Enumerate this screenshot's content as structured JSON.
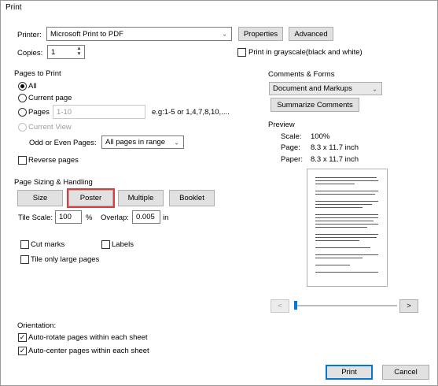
{
  "window": {
    "title": "Print"
  },
  "printer": {
    "label": "Printer:",
    "value": "Microsoft Print to PDF",
    "properties_label": "Properties",
    "advanced_label": "Advanced"
  },
  "copies": {
    "label": "Copies:",
    "value": "1"
  },
  "grayscale": {
    "label": "Print in grayscale(black and white)",
    "checked": false
  },
  "pages_to_print": {
    "heading": "Pages to Print",
    "all_label": "All",
    "current_page_label": "Current page",
    "pages_label": "Pages",
    "pages_placeholder": "1-10",
    "pages_hint": "e.g:1-5 or 1,4,7,8,10,....",
    "current_view_label": "Current View",
    "odd_even_label": "Odd or Even Pages:",
    "odd_even_value": "All pages in range",
    "reverse_label": "Reverse pages"
  },
  "comments_forms": {
    "heading": "Comments & Forms",
    "value": "Document and Markups",
    "summarize_label": "Summarize Comments"
  },
  "preview": {
    "heading": "Preview",
    "scale_label": "Scale:",
    "scale_value": "100%",
    "page_label": "Page:",
    "page_value": "8.3 x 11.7 inch",
    "paper_label": "Paper:",
    "paper_value": "8.3 x 11.7 inch",
    "prev_label": "<",
    "next_label": ">"
  },
  "page_sizing": {
    "heading": "Page Sizing & Handling",
    "tabs": [
      "Size",
      "Poster",
      "Multiple",
      "Booklet"
    ],
    "selected_tab": "Poster",
    "tile_scale_label": "Tile Scale:",
    "tile_scale_value": "100",
    "percent": "%",
    "overlap_label": "Overlap:",
    "overlap_value": "0.005",
    "overlap_unit": "in",
    "cut_marks_label": "Cut marks",
    "labels_label": "Labels",
    "tile_large_label": "Tile only large pages"
  },
  "orientation": {
    "heading": "Orientation:",
    "auto_rotate_label": "Auto-rotate pages within each sheet",
    "auto_center_label": "Auto-center pages within each sheet"
  },
  "footer": {
    "print_label": "Print",
    "cancel_label": "Cancel"
  },
  "colors": {
    "accent": "#0078d7",
    "highlight": "#e23b3b"
  }
}
